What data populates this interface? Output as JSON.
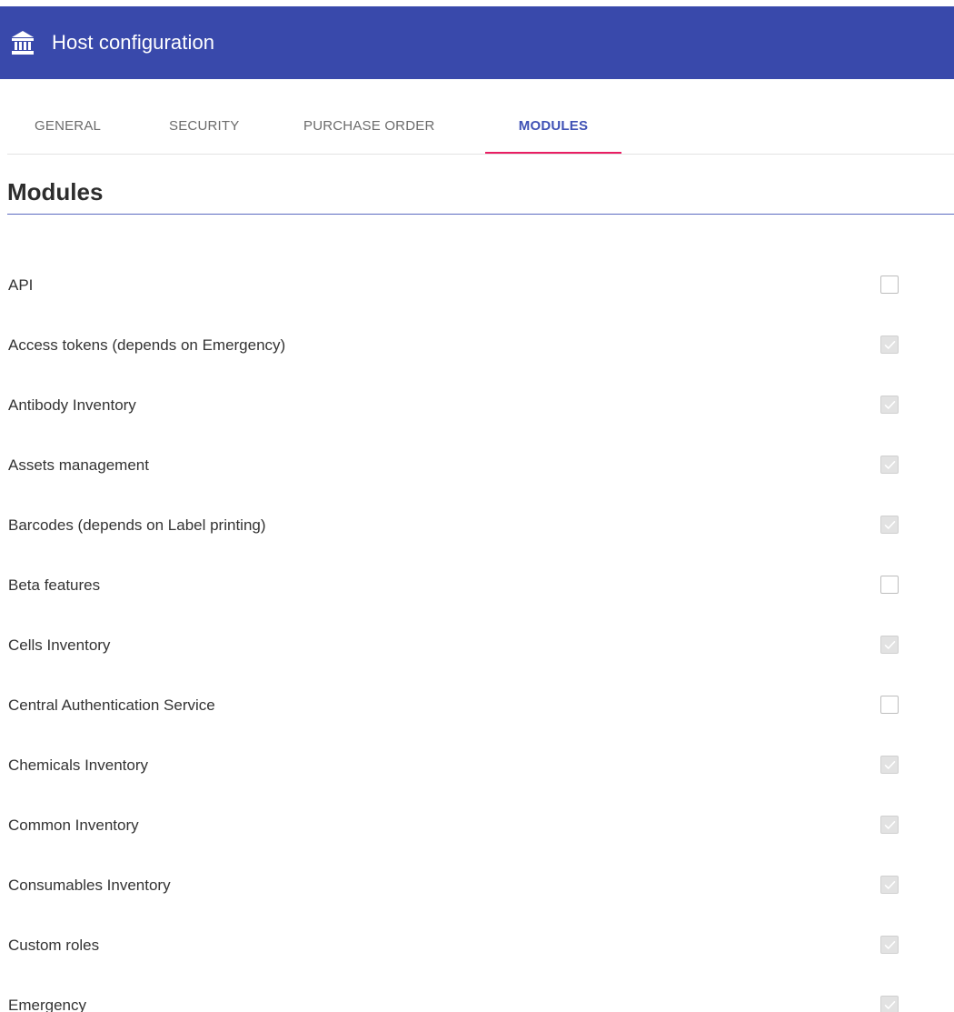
{
  "header": {
    "icon": "bank-icon",
    "title": "Host configuration",
    "background_color": "#3949ab"
  },
  "tabs": [
    {
      "label": "GENERAL",
      "active": false
    },
    {
      "label": "SECURITY",
      "active": false
    },
    {
      "label": "PURCHASE ORDER",
      "active": false
    },
    {
      "label": "MODULES",
      "active": true
    }
  ],
  "accent_color": "#3f51b5",
  "tab_indicator_color": "#e91e63",
  "section": {
    "title": "Modules"
  },
  "modules": [
    {
      "label": "API",
      "checked": false
    },
    {
      "label": "Access tokens (depends on Emergency)",
      "checked": true
    },
    {
      "label": "Antibody Inventory",
      "checked": true
    },
    {
      "label": "Assets management",
      "checked": true
    },
    {
      "label": "Barcodes (depends on Label printing)",
      "checked": true
    },
    {
      "label": "Beta features",
      "checked": false
    },
    {
      "label": "Cells Inventory",
      "checked": true
    },
    {
      "label": "Central Authentication Service",
      "checked": false
    },
    {
      "label": "Chemicals Inventory",
      "checked": true
    },
    {
      "label": "Common Inventory",
      "checked": true
    },
    {
      "label": "Consumables Inventory",
      "checked": true
    },
    {
      "label": "Custom roles",
      "checked": true
    },
    {
      "label": "Emergency",
      "checked": true
    }
  ]
}
